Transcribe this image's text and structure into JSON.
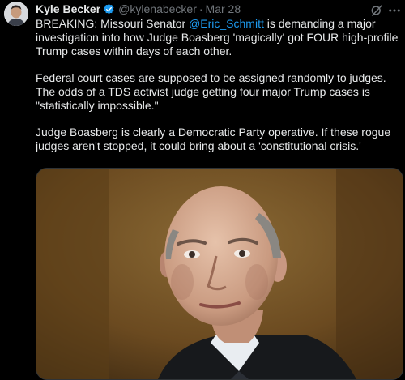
{
  "author": {
    "display_name": "Kyle Becker",
    "handle": "@kylenabecker",
    "separator": "·",
    "date": "Mar 28",
    "verified": true
  },
  "icons": {
    "avatar": "avatar-photo",
    "verified": "verified-badge-icon",
    "grok": "grok-icon",
    "more": "more-options-icon"
  },
  "colors": {
    "background": "#000000",
    "text": "#e7e9ea",
    "muted": "#71767b",
    "link": "#1d9bf0",
    "verified": "#1d9bf0"
  },
  "tweet": {
    "p1_before": "BREAKING: Missouri Senator ",
    "p1_mention": "@Eric_Schmitt",
    "p1_after": " is demanding a major investigation into how Judge Boasberg 'magically' got FOUR high-profile Trump cases within days of each other.",
    "p2": "Federal court cases are supposed to be assigned randomly to judges. The odds of a TDS activist judge getting four major Trump cases is \"statistically impossible.\"",
    "p3": "Judge Boasberg is clearly a Democratic Party operative. If these rogue judges aren't stopped, it could bring about a 'constitutional crisis.'"
  },
  "media": {
    "kind": "photo",
    "subject": "portrait-of-man-in-suit"
  }
}
